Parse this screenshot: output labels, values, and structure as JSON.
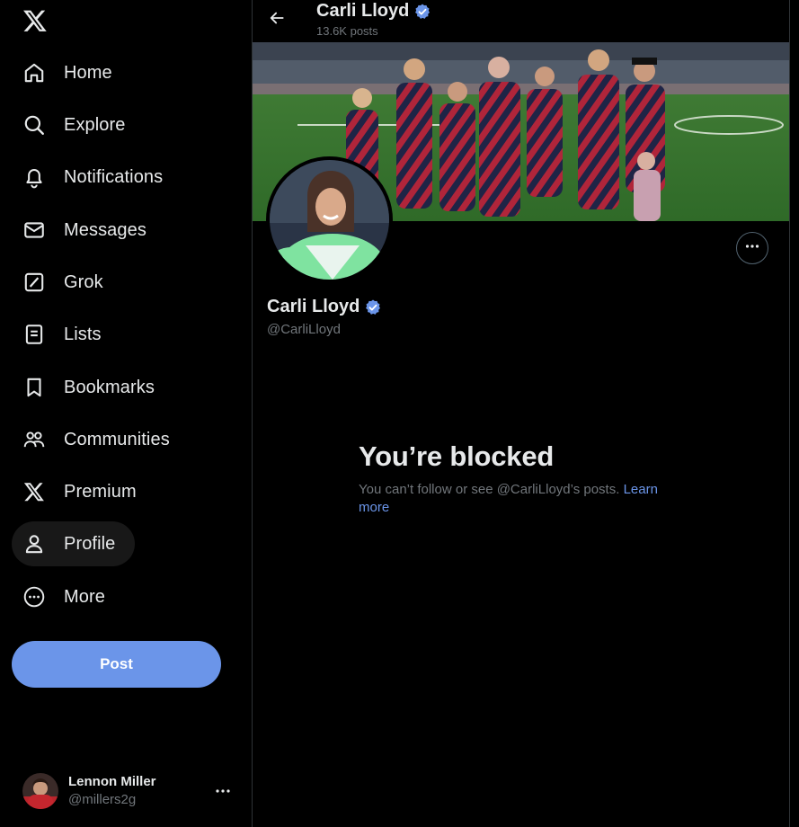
{
  "sidebar": {
    "logo_icon": "x-logo-icon",
    "items": [
      {
        "label": "Home",
        "icon": "home-icon"
      },
      {
        "label": "Explore",
        "icon": "search-icon"
      },
      {
        "label": "Notifications",
        "icon": "bell-icon"
      },
      {
        "label": "Messages",
        "icon": "envelope-icon"
      },
      {
        "label": "Grok",
        "icon": "grok-icon"
      },
      {
        "label": "Lists",
        "icon": "list-icon"
      },
      {
        "label": "Bookmarks",
        "icon": "bookmark-icon"
      },
      {
        "label": "Communities",
        "icon": "communities-icon"
      },
      {
        "label": "Premium",
        "icon": "x-logo-icon"
      },
      {
        "label": "Profile",
        "icon": "person-icon",
        "active": true
      },
      {
        "label": "More",
        "icon": "more-circle-icon"
      }
    ],
    "post_label": "Post",
    "account": {
      "display_name": "Lennon Miller",
      "handle": "@millers2g"
    }
  },
  "main": {
    "header": {
      "title": "Carli Lloyd",
      "posts_count": "13.6K posts"
    },
    "profile": {
      "name": "Carli Lloyd",
      "handle": "@CarliLloyd"
    },
    "blocked": {
      "heading": "You’re blocked",
      "message": "You can’t follow or see @CarliLloyd’s posts.",
      "link": "Learn more"
    }
  },
  "colors": {
    "background": "#000000",
    "accent": "#6b95e9",
    "verified": "#6b95e9",
    "muted_text": "#71767b",
    "border": "#2f3336"
  }
}
